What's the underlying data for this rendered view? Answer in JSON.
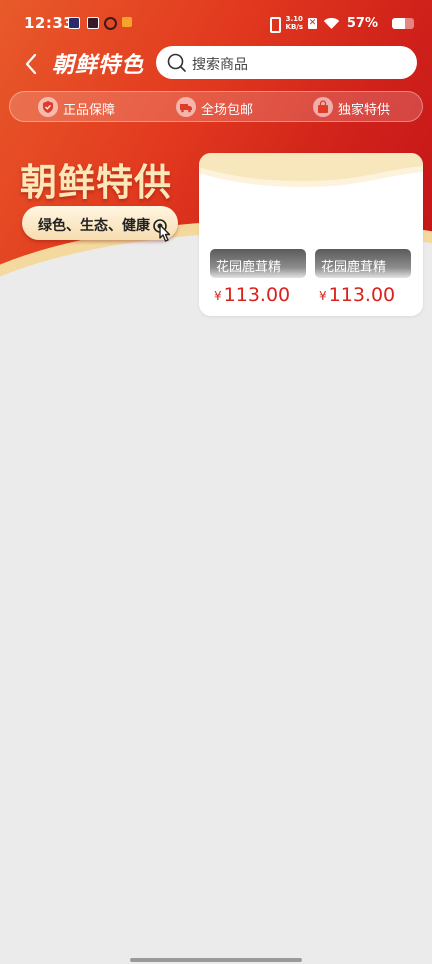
{
  "status_bar": {
    "time": "12:33",
    "net_speed_value": "3.10",
    "net_speed_unit": "KB/s",
    "battery_percent": "57%",
    "battery_level": 0.57
  },
  "header": {
    "title": "朝鲜特色",
    "search_placeholder": "搜索商品"
  },
  "guarantees": [
    {
      "icon": "shield-check-icon",
      "label": "正品保障"
    },
    {
      "icon": "truck-icon",
      "label": "全场包邮"
    },
    {
      "icon": "gift-bag-icon",
      "label": "独家特供"
    }
  ],
  "hero": {
    "headline": "朝鲜特供",
    "tagline": "绿色、生态、健康"
  },
  "products": [
    {
      "name": "花园鹿茸精",
      "currency": "¥",
      "price": "113.00"
    },
    {
      "name": "花园鹿茸精",
      "currency": "¥",
      "price": "113.00"
    }
  ],
  "colors": {
    "brand_red": "#d8231d",
    "hero_gold": "#fbe7b8",
    "background": "#ebebeb"
  }
}
